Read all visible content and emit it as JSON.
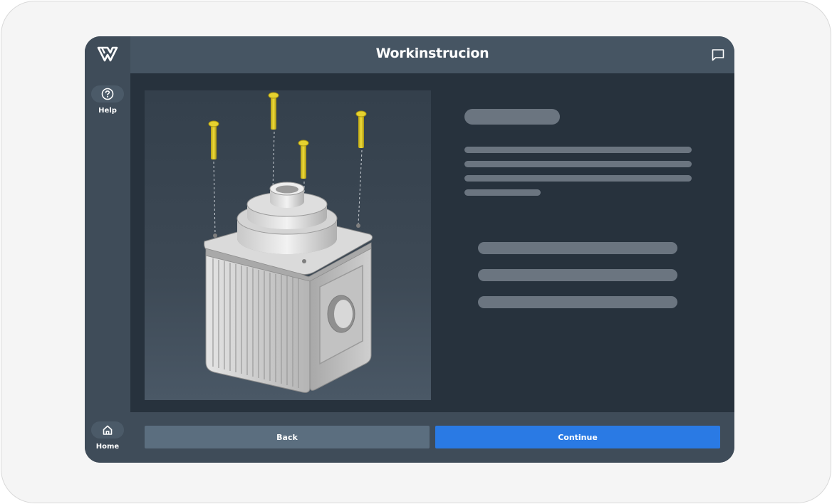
{
  "app": {
    "title": "Workinstrucion",
    "brand_icon": "w-logo-icon"
  },
  "sidebar": {
    "help_label": "Help",
    "help_icon": "help-circle-icon",
    "home_label": "Home",
    "home_icon": "home-icon"
  },
  "header": {
    "chat_icon": "chat-bubble-icon"
  },
  "viewer": {
    "content": "3d-model-exploded-view"
  },
  "footer": {
    "back_label": "Back",
    "continue_label": "Continue"
  },
  "colors": {
    "accent": "#2a7ae4",
    "sidebar": "#3f4c59",
    "header": "#465563",
    "background": "#27323d",
    "screw": "#d6c21f",
    "skeleton": "#6b7580"
  }
}
